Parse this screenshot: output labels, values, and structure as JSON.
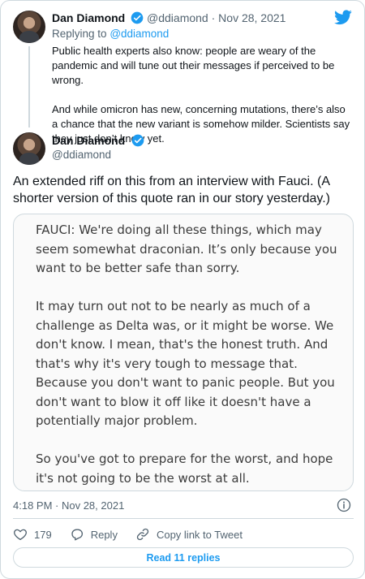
{
  "colors": {
    "accent": "#1d9bf0",
    "muted": "#536471",
    "border": "#cfd9de",
    "text": "#0f1419"
  },
  "tweet1": {
    "author_name": "Dan Diamond",
    "author_handle": "@ddiamond",
    "separator": "·",
    "date": "Nov 28, 2021",
    "replying_prefix": "Replying to",
    "replying_handle": "@ddiamond",
    "paragraphs": [
      "Public health experts also know: people are weary of the pandemic and will tune out their messages if perceived to be wrong.",
      "And while omicron has new, concerning mutations, there’s also a chance that the new variant is somehow milder. Scientists say they just don’t know yet."
    ]
  },
  "tweet2": {
    "author_name": "Dan Diamond",
    "author_handle": "@ddiamond",
    "text": "An extended riff on this from an interview with Fauci. (A shorter version of this quote ran in our story yesterday.)",
    "image_paragraphs": [
      "FAUCI: We're doing all these things, which may seem somewhat draconian. It’s only because you want to be better safe than sorry.",
      "It may turn out not to be nearly as much of a challenge as Delta was, or it might be worse. We don't know. I mean, that's the honest truth. And that's why it's very tough to message that. Because you don't want to panic people. But you don't want to blow it off like it doesn't have a potentially major problem.",
      "So you've got to prepare for the worst, and hope it's not going to be the worst at all."
    ],
    "timestamp": "4:18 PM · Nov 28, 2021"
  },
  "actions": {
    "like_count": "179",
    "reply_label": "Reply",
    "copy_link_label": "Copy link to Tweet"
  },
  "read_replies_label": "Read 11 replies",
  "icons": [
    "twitter-logo-icon",
    "verified-badge-icon",
    "info-icon",
    "heart-icon",
    "reply-icon",
    "link-icon"
  ]
}
